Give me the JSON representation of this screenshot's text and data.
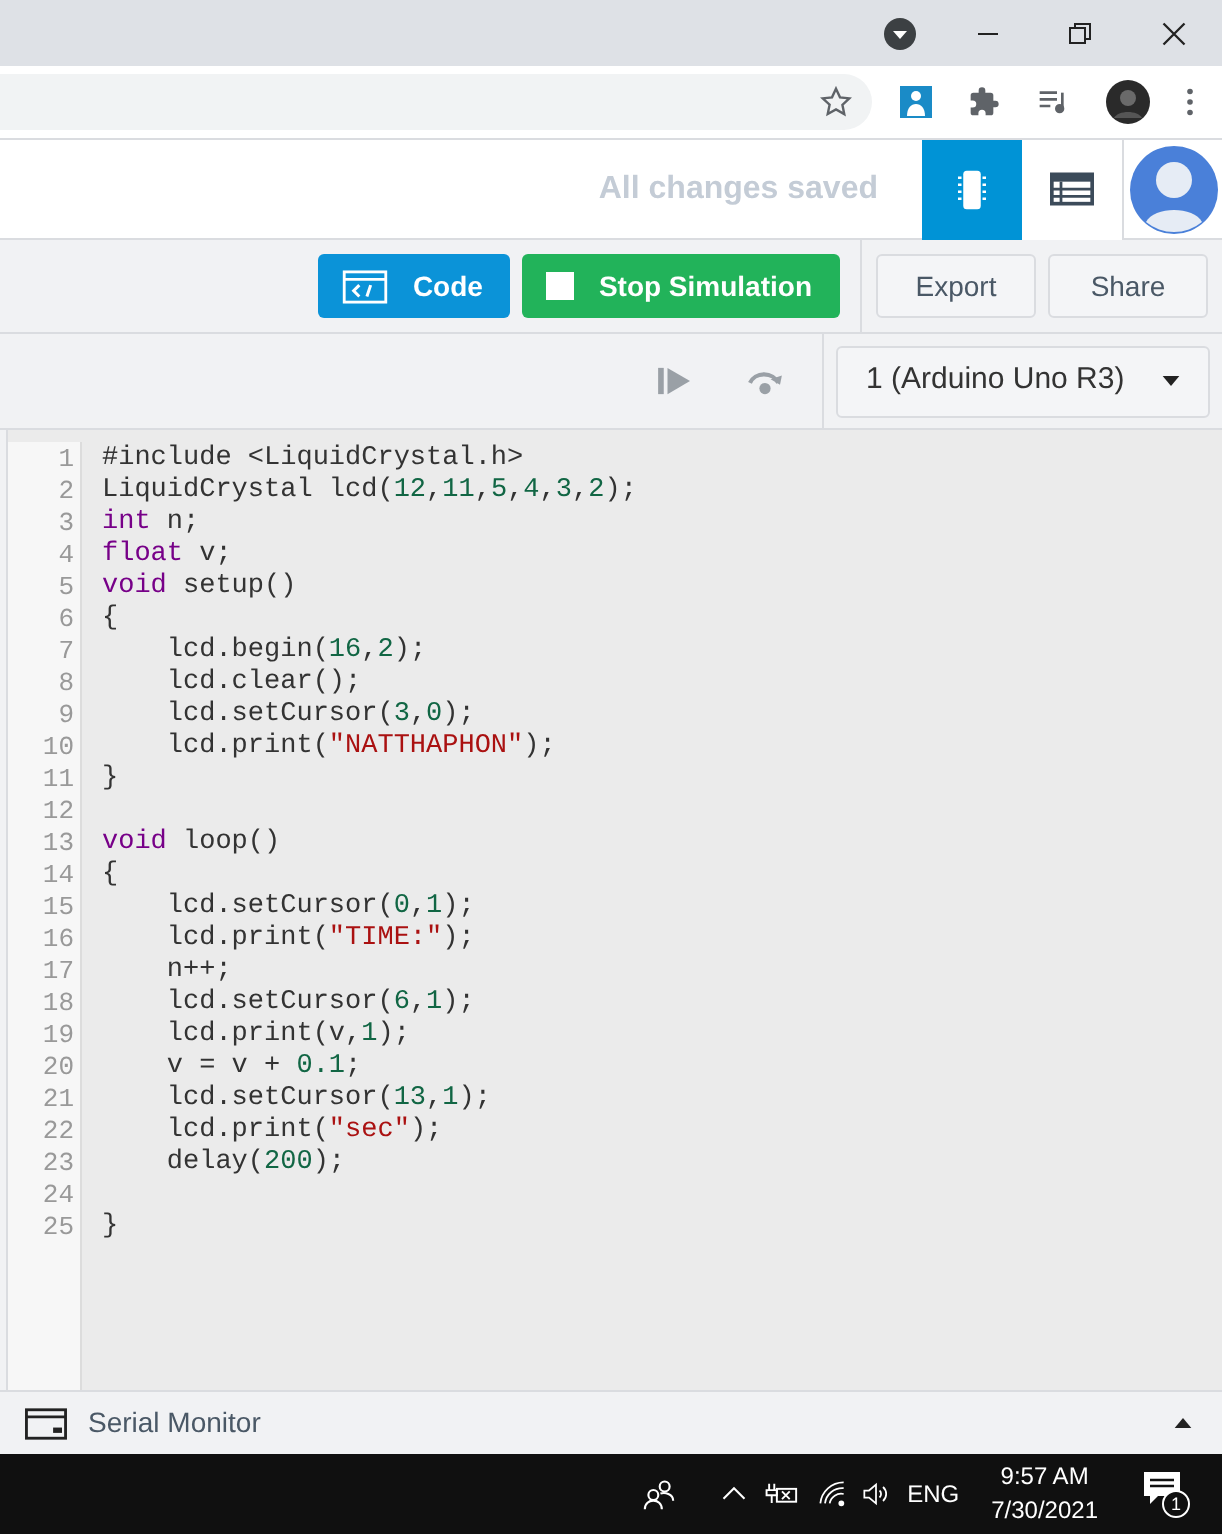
{
  "header": {
    "status": "All changes saved",
    "view_tabs": [
      {
        "kind": "components",
        "selected": true
      },
      {
        "kind": "list",
        "selected": false
      }
    ]
  },
  "toolbar": {
    "buttons": [
      {
        "kind": "code",
        "label": "Code"
      },
      {
        "kind": "stop",
        "label": "Stop Simulation"
      },
      {
        "kind": "plain",
        "label": "Export"
      },
      {
        "kind": "plain",
        "label": "Share"
      }
    ]
  },
  "sim_bar": {
    "device": "1 (Arduino Uno R3)"
  },
  "code": [
    {
      "kind": "code",
      "tokens": [
        {
          "kind": "plain",
          "text": "#include <LiquidCrystal.h>"
        }
      ]
    },
    {
      "kind": "code",
      "tokens": [
        {
          "kind": "plain",
          "text": "LiquidCrystal lcd("
        },
        {
          "kind": "num",
          "text": "12"
        },
        {
          "kind": "plain",
          "text": ","
        },
        {
          "kind": "num",
          "text": "11"
        },
        {
          "kind": "plain",
          "text": ","
        },
        {
          "kind": "num",
          "text": "5"
        },
        {
          "kind": "plain",
          "text": ","
        },
        {
          "kind": "num",
          "text": "4"
        },
        {
          "kind": "plain",
          "text": ","
        },
        {
          "kind": "num",
          "text": "3"
        },
        {
          "kind": "plain",
          "text": ","
        },
        {
          "kind": "num",
          "text": "2"
        },
        {
          "kind": "plain",
          "text": ");"
        }
      ]
    },
    {
      "kind": "code",
      "tokens": [
        {
          "kind": "kw",
          "text": "int"
        },
        {
          "kind": "plain",
          "text": " n;"
        }
      ]
    },
    {
      "kind": "code",
      "tokens": [
        {
          "kind": "kw",
          "text": "float"
        },
        {
          "kind": "plain",
          "text": " v;"
        }
      ]
    },
    {
      "kind": "code",
      "tokens": [
        {
          "kind": "kw",
          "text": "void"
        },
        {
          "kind": "plain",
          "text": " setup()"
        }
      ]
    },
    {
      "kind": "code",
      "tokens": [
        {
          "kind": "plain",
          "text": "{"
        }
      ]
    },
    {
      "kind": "code",
      "tokens": [
        {
          "kind": "plain",
          "text": "    lcd.begin("
        },
        {
          "kind": "num",
          "text": "16"
        },
        {
          "kind": "plain",
          "text": ","
        },
        {
          "kind": "num",
          "text": "2"
        },
        {
          "kind": "plain",
          "text": ");"
        }
      ]
    },
    {
      "kind": "code",
      "tokens": [
        {
          "kind": "plain",
          "text": "    lcd.clear();"
        }
      ]
    },
    {
      "kind": "code",
      "tokens": [
        {
          "kind": "plain",
          "text": "    lcd.setCursor("
        },
        {
          "kind": "num",
          "text": "3"
        },
        {
          "kind": "plain",
          "text": ","
        },
        {
          "kind": "num",
          "text": "0"
        },
        {
          "kind": "plain",
          "text": ");"
        }
      ]
    },
    {
      "kind": "code",
      "tokens": [
        {
          "kind": "plain",
          "text": "    lcd.print("
        },
        {
          "kind": "str",
          "text": "\"NATTHAPHON\""
        },
        {
          "kind": "plain",
          "text": ");"
        }
      ]
    },
    {
      "kind": "code",
      "tokens": [
        {
          "kind": "plain",
          "text": "}"
        }
      ]
    },
    {
      "kind": "blank"
    },
    {
      "kind": "code",
      "tokens": [
        {
          "kind": "kw",
          "text": "void"
        },
        {
          "kind": "plain",
          "text": " loop()"
        }
      ]
    },
    {
      "kind": "code",
      "tokens": [
        {
          "kind": "plain",
          "text": "{"
        }
      ]
    },
    {
      "kind": "code",
      "tokens": [
        {
          "kind": "plain",
          "text": "    lcd.setCursor("
        },
        {
          "kind": "num",
          "text": "0"
        },
        {
          "kind": "plain",
          "text": ","
        },
        {
          "kind": "num",
          "text": "1"
        },
        {
          "kind": "plain",
          "text": ");"
        }
      ]
    },
    {
      "kind": "code",
      "tokens": [
        {
          "kind": "plain",
          "text": "    lcd.print("
        },
        {
          "kind": "str",
          "text": "\"TIME:\""
        },
        {
          "kind": "plain",
          "text": ");"
        }
      ]
    },
    {
      "kind": "code",
      "tokens": [
        {
          "kind": "plain",
          "text": "    n++;"
        }
      ]
    },
    {
      "kind": "code",
      "tokens": [
        {
          "kind": "plain",
          "text": "    lcd.setCursor("
        },
        {
          "kind": "num",
          "text": "6"
        },
        {
          "kind": "plain",
          "text": ","
        },
        {
          "kind": "num",
          "text": "1"
        },
        {
          "kind": "plain",
          "text": ");"
        }
      ]
    },
    {
      "kind": "code",
      "tokens": [
        {
          "kind": "plain",
          "text": "    lcd.print(v,"
        },
        {
          "kind": "num",
          "text": "1"
        },
        {
          "kind": "plain",
          "text": ");"
        }
      ]
    },
    {
      "kind": "code",
      "tokens": [
        {
          "kind": "plain",
          "text": "    v = v + "
        },
        {
          "kind": "num",
          "text": "0.1"
        },
        {
          "kind": "plain",
          "text": ";"
        }
      ]
    },
    {
      "kind": "code",
      "tokens": [
        {
          "kind": "plain",
          "text": "    lcd.setCursor("
        },
        {
          "kind": "num",
          "text": "13"
        },
        {
          "kind": "plain",
          "text": ","
        },
        {
          "kind": "num",
          "text": "1"
        },
        {
          "kind": "plain",
          "text": ");"
        }
      ]
    },
    {
      "kind": "code",
      "tokens": [
        {
          "kind": "plain",
          "text": "    lcd.print("
        },
        {
          "kind": "str",
          "text": "\"sec\""
        },
        {
          "kind": "plain",
          "text": ");"
        }
      ]
    },
    {
      "kind": "code",
      "tokens": [
        {
          "kind": "plain",
          "text": "    delay("
        },
        {
          "kind": "num",
          "text": "200"
        },
        {
          "kind": "plain",
          "text": ");"
        }
      ]
    },
    {
      "kind": "blank"
    },
    {
      "kind": "code",
      "tokens": [
        {
          "kind": "plain",
          "text": "}"
        }
      ]
    }
  ],
  "line_numbers": [
    "1",
    "2",
    "3",
    "4",
    "5",
    "6",
    "7",
    "8",
    "9",
    "10",
    "11",
    "12",
    "13",
    "14",
    "15",
    "16",
    "17",
    "18",
    "19",
    "20",
    "21",
    "22",
    "23",
    "24",
    "25"
  ],
  "serial_monitor": {
    "label": "Serial Monitor"
  },
  "taskbar": {
    "language": "ENG",
    "time": "9:57 AM",
    "date": "7/30/2021",
    "notifications": "1"
  }
}
